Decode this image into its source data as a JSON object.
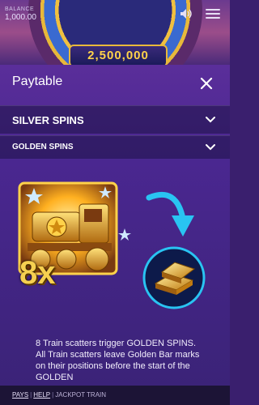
{
  "game": {
    "balance_label": "BALANCE",
    "balance_value": "1,000.00",
    "wheel_value": "2,500,000"
  },
  "modal": {
    "title": "Paytable",
    "sections": [
      {
        "label": "SILVER SPINS"
      },
      {
        "label": "GOLDEN SPINS"
      }
    ]
  },
  "content": {
    "multiplier": "8x",
    "description": "8 Train scatters trigger GOLDEN SPINS. All Train scatters leave Golden Bar marks on their positions before the start of the GOLDEN"
  },
  "footer": {
    "pays": "PAYS",
    "help": "HELP",
    "game_name": "JACKPOT TRAIN"
  },
  "colors": {
    "modal_bg": "#4a2790",
    "gold": "#f6d050",
    "arrow": "#29c4f2"
  },
  "icons": [
    "speaker-icon",
    "menu-icon",
    "close-icon",
    "chevron-down-icon",
    "train-icon",
    "arrow-icon",
    "gold-bar-icon"
  ]
}
